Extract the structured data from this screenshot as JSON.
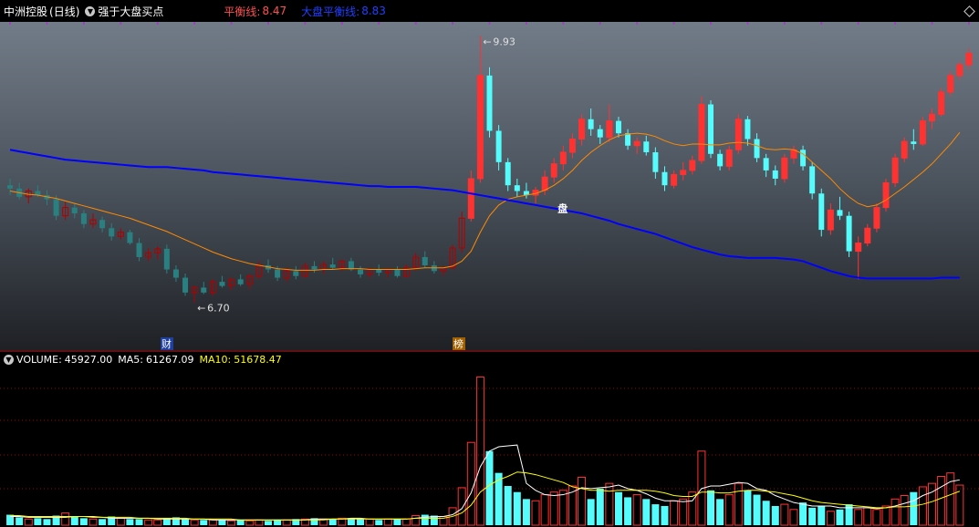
{
  "header": {
    "stock_name": "中洲控股",
    "period": "(日线)",
    "indicator": "强于大盘买点",
    "balance_label": "平衡线:",
    "balance_value": "8.47",
    "market_label": "大盘平衡线:",
    "market_value": "8.83"
  },
  "annotations": {
    "high_label": "9.93",
    "low_label": "6.70",
    "marker_cai": "财",
    "marker_bang": "榜",
    "marker_pan": "盘"
  },
  "volume_header": {
    "volume_label": "VOLUME:",
    "volume_value": "45927.00",
    "ma5_label": "MA5:",
    "ma5_value": "61267.09",
    "ma10_label": "MA10:",
    "ma10_value": "51678.47"
  },
  "colors": {
    "up": "#ff3232",
    "down": "#54fcfc",
    "up_dark": "#b00000",
    "down_dark": "#2a8080",
    "ma_orange": "#ff8a00",
    "ma_blue": "#0000ff",
    "grid_red": "#a00000",
    "ma5_vol": "#ffffff",
    "ma10_vol": "#ffff00"
  },
  "chart_data": [
    {
      "type": "candlestick",
      "series": [
        {
          "name": "K",
          "ohlc": [
            [
              8.12,
              8.2,
              8.0,
              8.08
            ],
            [
              8.08,
              8.15,
              7.95,
              7.98
            ],
            [
              7.98,
              8.08,
              7.9,
              8.05
            ],
            [
              8.05,
              8.12,
              7.98,
              8.0
            ],
            [
              8.0,
              8.06,
              7.88,
              7.95
            ],
            [
              7.95,
              8.0,
              7.7,
              7.75
            ],
            [
              7.75,
              7.92,
              7.7,
              7.85
            ],
            [
              7.85,
              7.9,
              7.72,
              7.78
            ],
            [
              7.78,
              7.82,
              7.6,
              7.65
            ],
            [
              7.65,
              7.78,
              7.6,
              7.7
            ],
            [
              7.7,
              7.74,
              7.55,
              7.6
            ],
            [
              7.6,
              7.66,
              7.45,
              7.5
            ],
            [
              7.5,
              7.6,
              7.46,
              7.55
            ],
            [
              7.55,
              7.58,
              7.4,
              7.42
            ],
            [
              7.42,
              7.48,
              7.2,
              7.25
            ],
            [
              7.25,
              7.36,
              7.2,
              7.3
            ],
            [
              7.3,
              7.38,
              7.22,
              7.35
            ],
            [
              7.35,
              7.4,
              7.05,
              7.1
            ],
            [
              7.1,
              7.15,
              6.95,
              7.0
            ],
            [
              7.0,
              7.05,
              6.78,
              6.82
            ],
            [
              6.82,
              6.9,
              6.7,
              6.88
            ],
            [
              6.88,
              6.95,
              6.8,
              6.82
            ],
            [
              6.82,
              6.98,
              6.78,
              6.95
            ],
            [
              6.95,
              7.02,
              6.88,
              6.9
            ],
            [
              6.9,
              7.0,
              6.85,
              6.98
            ],
            [
              6.98,
              7.04,
              6.9,
              6.92
            ],
            [
              6.92,
              7.05,
              6.86,
              7.02
            ],
            [
              7.02,
              7.2,
              6.98,
              7.15
            ],
            [
              7.15,
              7.22,
              7.06,
              7.1
            ],
            [
              7.1,
              7.14,
              6.96,
              7.0
            ],
            [
              7.0,
              7.12,
              6.95,
              7.08
            ],
            [
              7.08,
              7.14,
              6.98,
              7.02
            ],
            [
              7.02,
              7.18,
              7.0,
              7.14
            ],
            [
              7.14,
              7.2,
              7.06,
              7.1
            ],
            [
              7.1,
              7.2,
              7.04,
              7.16
            ],
            [
              7.16,
              7.24,
              7.1,
              7.12
            ],
            [
              7.12,
              7.22,
              7.08,
              7.2
            ],
            [
              7.2,
              7.24,
              7.08,
              7.1
            ],
            [
              7.1,
              7.14,
              7.0,
              7.04
            ],
            [
              7.04,
              7.12,
              7.0,
              7.1
            ],
            [
              7.1,
              7.16,
              7.02,
              7.06
            ],
            [
              7.06,
              7.12,
              7.0,
              7.1
            ],
            [
              7.1,
              7.14,
              7.0,
              7.02
            ],
            [
              7.02,
              7.16,
              7.0,
              7.12
            ],
            [
              7.12,
              7.3,
              7.08,
              7.25
            ],
            [
              7.25,
              7.32,
              7.12,
              7.15
            ],
            [
              7.15,
              7.2,
              7.05,
              7.08
            ],
            [
              7.08,
              7.14,
              7.02,
              7.12
            ],
            [
              7.12,
              7.4,
              7.1,
              7.36
            ],
            [
              7.36,
              7.8,
              7.3,
              7.72
            ],
            [
              7.72,
              8.3,
              7.68,
              8.2
            ],
            [
              8.2,
              9.93,
              8.15,
              9.45
            ],
            [
              9.45,
              9.55,
              8.7,
              8.78
            ],
            [
              8.78,
              8.85,
              8.3,
              8.4
            ],
            [
              8.4,
              8.45,
              8.05,
              8.12
            ],
            [
              8.12,
              8.2,
              7.98,
              8.05
            ],
            [
              8.05,
              8.15,
              7.96,
              8.0
            ],
            [
              8.0,
              8.1,
              7.9,
              8.06
            ],
            [
              8.06,
              8.3,
              8.0,
              8.22
            ],
            [
              8.22,
              8.45,
              8.15,
              8.38
            ],
            [
              8.38,
              8.6,
              8.3,
              8.52
            ],
            [
              8.52,
              8.75,
              8.45,
              8.68
            ],
            [
              8.68,
              8.98,
              8.6,
              8.92
            ],
            [
              8.92,
              9.05,
              8.72,
              8.8
            ],
            [
              8.8,
              8.85,
              8.62,
              8.7
            ],
            [
              8.7,
              9.1,
              8.64,
              8.9
            ],
            [
              8.9,
              8.95,
              8.7,
              8.75
            ],
            [
              8.75,
              8.8,
              8.55,
              8.6
            ],
            [
              8.6,
              8.7,
              8.5,
              8.65
            ],
            [
              8.65,
              8.72,
              8.48,
              8.52
            ],
            [
              8.52,
              8.58,
              8.2,
              8.28
            ],
            [
              8.28,
              8.35,
              8.05,
              8.12
            ],
            [
              8.12,
              8.3,
              8.08,
              8.25
            ],
            [
              8.25,
              8.4,
              8.18,
              8.3
            ],
            [
              8.3,
              8.48,
              8.25,
              8.42
            ],
            [
              8.42,
              9.2,
              8.38,
              9.1
            ],
            [
              9.1,
              9.15,
              8.45,
              8.5
            ],
            [
              8.5,
              8.55,
              8.3,
              8.35
            ],
            [
              8.35,
              8.6,
              8.3,
              8.55
            ],
            [
              8.55,
              8.98,
              8.5,
              8.92
            ],
            [
              8.92,
              8.96,
              8.6,
              8.68
            ],
            [
              8.68,
              8.75,
              8.4,
              8.45
            ],
            [
              8.45,
              8.5,
              8.22,
              8.3
            ],
            [
              8.3,
              8.36,
              8.12,
              8.2
            ],
            [
              8.2,
              8.5,
              8.15,
              8.45
            ],
            [
              8.45,
              8.6,
              8.38,
              8.55
            ],
            [
              8.55,
              8.6,
              8.3,
              8.35
            ],
            [
              8.35,
              8.4,
              7.95,
              8.02
            ],
            [
              8.02,
              8.08,
              7.5,
              7.58
            ],
            [
              7.58,
              7.9,
              7.52,
              7.82
            ],
            [
              7.82,
              7.98,
              7.7,
              7.75
            ],
            [
              7.75,
              7.8,
              7.25,
              7.32
            ],
            [
              7.32,
              7.5,
              6.98,
              7.42
            ],
            [
              7.42,
              7.65,
              7.38,
              7.6
            ],
            [
              7.6,
              7.9,
              7.55,
              7.85
            ],
            [
              7.85,
              8.2,
              7.8,
              8.15
            ],
            [
              8.15,
              8.5,
              8.1,
              8.45
            ],
            [
              8.45,
              8.7,
              8.4,
              8.65
            ],
            [
              8.65,
              8.8,
              8.55,
              8.62
            ],
            [
              8.62,
              8.95,
              8.6,
              8.9
            ],
            [
              8.9,
              9.05,
              8.8,
              8.98
            ],
            [
              8.98,
              9.3,
              8.95,
              9.25
            ],
            [
              9.25,
              9.5,
              9.2,
              9.45
            ],
            [
              9.45,
              9.62,
              9.4,
              9.58
            ],
            [
              9.58,
              9.78,
              9.52,
              9.72
            ]
          ]
        }
      ],
      "ma_balance": [
        8.05,
        8.03,
        8.01,
        8.0,
        7.98,
        7.96,
        7.93,
        7.9,
        7.87,
        7.84,
        7.81,
        7.78,
        7.75,
        7.72,
        7.68,
        7.64,
        7.6,
        7.56,
        7.51,
        7.46,
        7.41,
        7.36,
        7.31,
        7.27,
        7.23,
        7.2,
        7.17,
        7.15,
        7.13,
        7.11,
        7.1,
        7.09,
        7.09,
        7.09,
        7.1,
        7.1,
        7.11,
        7.11,
        7.11,
        7.1,
        7.1,
        7.1,
        7.1,
        7.1,
        7.11,
        7.12,
        7.12,
        7.12,
        7.14,
        7.2,
        7.32,
        7.55,
        7.75,
        7.88,
        7.95,
        7.98,
        8.0,
        8.02,
        8.06,
        8.12,
        8.2,
        8.3,
        8.42,
        8.52,
        8.6,
        8.67,
        8.72,
        8.74,
        8.75,
        8.74,
        8.71,
        8.66,
        8.62,
        8.6,
        8.62,
        8.62,
        8.61,
        8.61,
        8.63,
        8.64,
        8.63,
        8.6,
        8.56,
        8.55,
        8.56,
        8.55,
        8.5,
        8.4,
        8.3,
        8.2,
        8.08,
        7.98,
        7.9,
        7.86,
        7.88,
        7.94,
        8.02,
        8.1,
        8.19,
        8.28,
        8.38,
        8.5,
        8.62,
        8.76
      ],
      "ma_market": [
        8.55,
        8.53,
        8.51,
        8.49,
        8.47,
        8.45,
        8.43,
        8.42,
        8.41,
        8.4,
        8.39,
        8.38,
        8.37,
        8.36,
        8.35,
        8.34,
        8.34,
        8.34,
        8.33,
        8.32,
        8.31,
        8.3,
        8.28,
        8.27,
        8.26,
        8.25,
        8.24,
        8.23,
        8.22,
        8.21,
        8.2,
        8.19,
        8.18,
        8.17,
        8.16,
        8.15,
        8.14,
        8.13,
        8.12,
        8.11,
        8.11,
        8.1,
        8.1,
        8.1,
        8.1,
        8.09,
        8.08,
        8.07,
        8.06,
        8.04,
        8.02,
        8.0,
        7.98,
        7.96,
        7.94,
        7.92,
        7.9,
        7.88,
        7.86,
        7.84,
        7.82,
        7.8,
        7.78,
        7.75,
        7.72,
        7.69,
        7.65,
        7.62,
        7.59,
        7.56,
        7.53,
        7.49,
        7.45,
        7.41,
        7.37,
        7.34,
        7.31,
        7.28,
        7.26,
        7.25,
        7.24,
        7.24,
        7.24,
        7.24,
        7.23,
        7.22,
        7.2,
        7.16,
        7.12,
        7.08,
        7.05,
        7.02,
        7.0,
        6.99,
        6.99,
        6.99,
        6.99,
        6.99,
        6.99,
        6.99,
        6.99,
        7.0,
        7.0,
        7.0
      ],
      "ylim": [
        6.1,
        10.1
      ]
    },
    {
      "type": "bar",
      "name": "VOLUME",
      "values": [
        12,
        9,
        7,
        8,
        7,
        11,
        14,
        10,
        8,
        7,
        7,
        10,
        8,
        7,
        7,
        6,
        6,
        8,
        9,
        7,
        6,
        6,
        6,
        6,
        5,
        6,
        5,
        6,
        5,
        6,
        6,
        7,
        7,
        8,
        7,
        7,
        8,
        8,
        7,
        7,
        6,
        7,
        7,
        7,
        11,
        12,
        11,
        10,
        20,
        43,
        95,
        170,
        85,
        60,
        45,
        38,
        30,
        28,
        35,
        38,
        40,
        45,
        55,
        30,
        42,
        48,
        38,
        32,
        35,
        30,
        24,
        22,
        28,
        30,
        38,
        85,
        40,
        30,
        35,
        48,
        40,
        35,
        28,
        22,
        24,
        18,
        26,
        20,
        22,
        16,
        18,
        24,
        18,
        20,
        18,
        22,
        30,
        34,
        38,
        44,
        48,
        56,
        60,
        46
      ],
      "ma5": [
        10,
        10,
        9,
        9,
        9,
        9,
        9,
        10,
        10,
        10,
        9,
        8,
        8,
        8,
        8,
        8,
        7,
        7,
        7,
        7,
        7,
        7,
        6,
        6,
        6,
        6,
        6,
        6,
        6,
        6,
        6,
        6,
        6,
        7,
        7,
        7,
        7,
        8,
        8,
        7,
        7,
        7,
        7,
        7,
        8,
        9,
        10,
        10,
        12,
        19,
        37,
        67,
        85,
        90,
        91,
        92,
        48,
        40,
        35,
        34,
        35,
        38,
        43,
        42,
        43,
        44,
        46,
        42,
        40,
        36,
        31,
        28,
        28,
        27,
        28,
        42,
        45,
        45,
        47,
        49,
        48,
        42,
        40,
        34,
        30,
        26,
        24,
        22,
        22,
        22,
        20,
        20,
        20,
        20,
        19,
        20,
        22,
        25,
        28,
        34,
        38,
        44,
        50,
        52
      ],
      "ma10": [
        11,
        11,
        10,
        10,
        10,
        10,
        10,
        10,
        10,
        9,
        9,
        9,
        9,
        9,
        8,
        8,
        8,
        8,
        8,
        8,
        7,
        7,
        7,
        7,
        7,
        6,
        6,
        6,
        6,
        6,
        6,
        6,
        6,
        6,
        6,
        7,
        7,
        7,
        7,
        7,
        7,
        7,
        7,
        7,
        8,
        8,
        8,
        8,
        10,
        14,
        23,
        38,
        46,
        52,
        56,
        61,
        60,
        58,
        55,
        52,
        49,
        44,
        42,
        40,
        40,
        39,
        40,
        40,
        40,
        40,
        39,
        37,
        34,
        33,
        33,
        38,
        38,
        37,
        37,
        39,
        40,
        40,
        39,
        38,
        36,
        34,
        31,
        28,
        26,
        25,
        24,
        23,
        22,
        21,
        20,
        20,
        21,
        21,
        22,
        24,
        27,
        31,
        35,
        39
      ],
      "ylim": [
        0,
        180
      ]
    }
  ]
}
